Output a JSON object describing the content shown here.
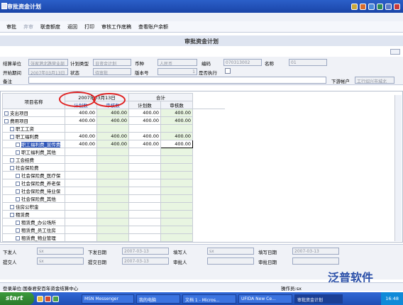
{
  "window": {
    "title": "审批资金计划"
  },
  "toolbar": {
    "items": [
      "审批",
      "弃审",
      "联查额度",
      "返回",
      "打印",
      "审核工作底稿",
      "查看账户余额"
    ]
  },
  "header": {
    "title": "审批资金计划"
  },
  "form": {
    "unit_label": "结算单位",
    "unit_value": "张家港北路营业部",
    "plan_type_label": "计划类型",
    "plan_type_value": "日资金计划",
    "currency_label": "币种",
    "currency_value": "人民币",
    "code_label": "编码",
    "code_value": "070313002",
    "name_label": "名称",
    "name_value": "01",
    "period_label": "开始期间",
    "period_value": "2007年03月13日",
    "status_label": "状态",
    "status_value": "待审批",
    "version_label": "版本号",
    "version_value": "1",
    "exec_label": "是否执行",
    "remark_label": "备注",
    "remark_value": "",
    "account_label": "下游帐户",
    "account_value": "工行绍兴市城北"
  },
  "grid": {
    "col_name": "项目名称",
    "date_header": "2007年03月13日",
    "total_header": "合计",
    "plan": "计划数",
    "approve": "审核数",
    "rows": [
      {
        "name": "支出项目",
        "level": 0,
        "v": [
          "400.00",
          "400.00",
          "400.00",
          "400.00"
        ]
      },
      {
        "name": "费用项目",
        "level": 0,
        "v": [
          "400.00",
          "400.00",
          "400.00",
          "400.00"
        ]
      },
      {
        "name": "职工工资",
        "level": 1,
        "v": [
          "",
          "",
          "",
          ""
        ]
      },
      {
        "name": "职工福利费",
        "level": 1,
        "v": [
          "400.00",
          "400.00",
          "400.00",
          "400.00"
        ]
      },
      {
        "name": "职工福利费_宣传费",
        "level": 2,
        "v": [
          "400.00",
          "400.00",
          "400.00",
          "400.00"
        ],
        "hl": true
      },
      {
        "name": "职工福利费_其他",
        "level": 2,
        "v": [
          "",
          "",
          "",
          ""
        ]
      },
      {
        "name": "工会经费",
        "level": 1,
        "v": [
          "",
          "",
          "",
          ""
        ]
      },
      {
        "name": "社会保险费",
        "level": 1,
        "v": [
          "",
          "",
          "",
          ""
        ]
      },
      {
        "name": "社会保险费_医疗保",
        "level": 2,
        "v": [
          "",
          "",
          "",
          ""
        ]
      },
      {
        "name": "社会保险费_养老保",
        "level": 2,
        "v": [
          "",
          "",
          "",
          ""
        ]
      },
      {
        "name": "社会保险费_待业保",
        "level": 2,
        "v": [
          "",
          "",
          "",
          ""
        ]
      },
      {
        "name": "社会保险费_其他",
        "level": 2,
        "v": [
          "",
          "",
          "",
          ""
        ]
      },
      {
        "name": "住房公积金",
        "level": 1,
        "v": [
          "",
          "",
          "",
          ""
        ]
      },
      {
        "name": "租赁费",
        "level": 1,
        "v": [
          "",
          "",
          "",
          ""
        ]
      },
      {
        "name": "租赁费_办公场所",
        "level": 2,
        "v": [
          "",
          "",
          "",
          ""
        ]
      },
      {
        "name": "租赁费_员工住房",
        "level": 2,
        "v": [
          "",
          "",
          "",
          ""
        ]
      },
      {
        "name": "租赁费_物业管理",
        "level": 2,
        "v": [
          "",
          "",
          "",
          ""
        ]
      }
    ]
  },
  "footer": {
    "issuer_label": "下发人",
    "issuer_value": "sx",
    "issue_date_label": "下发日期",
    "issue_date_value": "2007-03-13",
    "writer_label": "填写人",
    "writer_value": "sx",
    "write_date_label": "填写日期",
    "write_date_value": "2007-03-13",
    "submitter_label": "提交人",
    "submitter_value": "sx",
    "submit_date_label": "提交日期",
    "submit_date_value": "2007-03-13",
    "approver_label": "审批人",
    "approver_value": "",
    "approve_date_label": "审批日期",
    "approve_date_value": ""
  },
  "status": {
    "left": "登录单位:国泰君安百年资金结算中心",
    "operator": "操作员:sx",
    "logo": "泛普软件"
  },
  "taskbar": {
    "start": "start",
    "tasks": [
      "MSN Messenger",
      "我的电脑",
      "文档 1 - Micros...",
      "UFIDA New Ce...",
      "审批资金计划"
    ],
    "clock": "16:48"
  }
}
